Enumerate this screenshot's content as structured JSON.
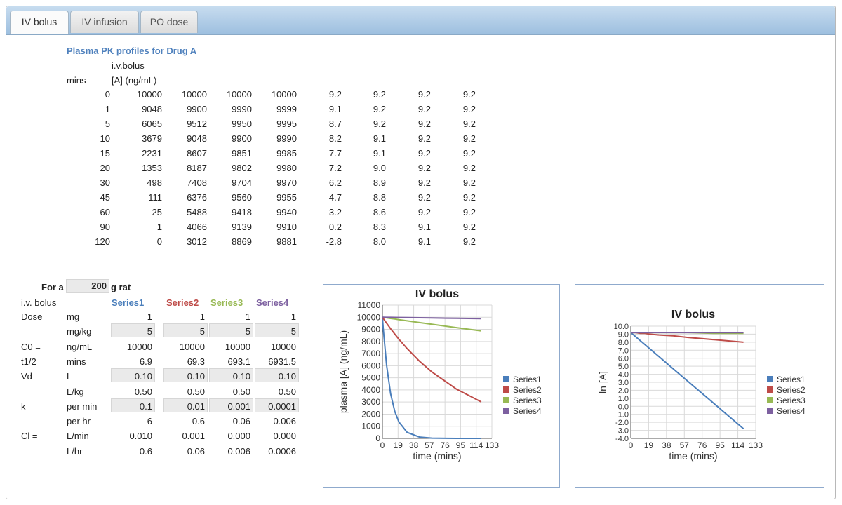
{
  "tabs": [
    {
      "label": "IV bolus",
      "active": true
    },
    {
      "label": "IV infusion",
      "active": false
    },
    {
      "label": "PO dose",
      "active": false
    }
  ],
  "table": {
    "title": "Plasma PK profiles for Drug A",
    "col_header_1": "i.v.bolus",
    "col_header_2": "[A] (ng/mL)",
    "time_header": "mins",
    "rows": [
      [
        "0",
        "10000",
        "10000",
        "10000",
        "10000",
        "9.2",
        "9.2",
        "9.2",
        "9.2"
      ],
      [
        "1",
        "9048",
        "9900",
        "9990",
        "9999",
        "9.1",
        "9.2",
        "9.2",
        "9.2"
      ],
      [
        "5",
        "6065",
        "9512",
        "9950",
        "9995",
        "8.7",
        "9.2",
        "9.2",
        "9.2"
      ],
      [
        "10",
        "3679",
        "9048",
        "9900",
        "9990",
        "8.2",
        "9.1",
        "9.2",
        "9.2"
      ],
      [
        "15",
        "2231",
        "8607",
        "9851",
        "9985",
        "7.7",
        "9.1",
        "9.2",
        "9.2"
      ],
      [
        "20",
        "1353",
        "8187",
        "9802",
        "9980",
        "7.2",
        "9.0",
        "9.2",
        "9.2"
      ],
      [
        "30",
        "498",
        "7408",
        "9704",
        "9970",
        "6.2",
        "8.9",
        "9.2",
        "9.2"
      ],
      [
        "45",
        "111",
        "6376",
        "9560",
        "9955",
        "4.7",
        "8.8",
        "9.2",
        "9.2"
      ],
      [
        "60",
        "25",
        "5488",
        "9418",
        "9940",
        "3.2",
        "8.6",
        "9.2",
        "9.2"
      ],
      [
        "90",
        "1",
        "4066",
        "9139",
        "9910",
        "0.2",
        "8.3",
        "9.1",
        "9.2"
      ],
      [
        "120",
        "0",
        "3012",
        "8869",
        "9881",
        "-2.8",
        "8.0",
        "9.1",
        "9.2"
      ]
    ]
  },
  "params": {
    "for_a": "For a",
    "weight": "200",
    "weight_unit": "g rat",
    "section": "i.v. bolus",
    "series_headers": [
      "Series1",
      "Series2",
      "Series3",
      "Series4"
    ],
    "rows": [
      {
        "label": "Dose",
        "unit": "mg",
        "values": [
          "1",
          "1",
          "1",
          "1"
        ],
        "input": false
      },
      {
        "label": "",
        "unit": "mg/kg",
        "values": [
          "5",
          "5",
          "5",
          "5"
        ],
        "input": true
      },
      {
        "label": "C0 =",
        "unit": "ng/mL",
        "values": [
          "10000",
          "10000",
          "10000",
          "10000"
        ],
        "input": false
      },
      {
        "label": "t1/2 =",
        "unit": "mins",
        "values": [
          "6.9",
          "69.3",
          "693.1",
          "6931.5"
        ],
        "input": false
      },
      {
        "label": "Vd",
        "unit": "L",
        "values": [
          "0.10",
          "0.10",
          "0.10",
          "0.10"
        ],
        "input": true
      },
      {
        "label": "",
        "unit": "L/kg",
        "values": [
          "0.50",
          "0.50",
          "0.50",
          "0.50"
        ],
        "input": false
      },
      {
        "label": "k",
        "unit": "per min",
        "values": [
          "0.1",
          "0.01",
          "0.001",
          "0.0001"
        ],
        "input": true
      },
      {
        "label": "",
        "unit": "per hr",
        "values": [
          "6",
          "0.6",
          "0.06",
          "0.006"
        ],
        "input": false
      },
      {
        "label": "Cl =",
        "unit": "L/min",
        "values": [
          "0.010",
          "0.001",
          "0.000",
          "0.000"
        ],
        "input": false
      },
      {
        "label": "",
        "unit": "L/hr",
        "values": [
          "0.6",
          "0.06",
          "0.006",
          "0.0006"
        ],
        "input": false
      }
    ]
  },
  "colors": {
    "series": [
      "#4a7ebb",
      "#be4b48",
      "#98b954",
      "#7d60a0"
    ],
    "accent": "#4f81bd",
    "tab_bar": "#a9c8e6"
  },
  "chart_data": [
    {
      "type": "line",
      "title": "IV bolus",
      "xlabel": "time (mins)",
      "ylabel": "plasma [A] (ng/mL)",
      "xlim": [
        0,
        133
      ],
      "ylim": [
        0,
        11000
      ],
      "xticks": [
        0,
        19,
        38,
        57,
        76,
        95,
        114,
        133
      ],
      "yticks": [
        0,
        1000,
        2000,
        3000,
        4000,
        5000,
        6000,
        7000,
        8000,
        9000,
        10000,
        11000
      ],
      "ytick_decimals": 0,
      "legend": "right",
      "x": [
        0,
        1,
        5,
        10,
        15,
        20,
        30,
        45,
        60,
        90,
        120
      ],
      "series": [
        {
          "name": "Series1",
          "values": [
            10000,
            9048,
            6065,
            3679,
            2231,
            1353,
            498,
            111,
            25,
            1,
            0
          ]
        },
        {
          "name": "Series2",
          "values": [
            10000,
            9900,
            9512,
            9048,
            8607,
            8187,
            7408,
            6376,
            5488,
            4066,
            3012
          ]
        },
        {
          "name": "Series3",
          "values": [
            10000,
            9990,
            9950,
            9900,
            9851,
            9802,
            9704,
            9560,
            9418,
            9139,
            8869
          ]
        },
        {
          "name": "Series4",
          "values": [
            10000,
            9999,
            9995,
            9990,
            9985,
            9980,
            9970,
            9955,
            9940,
            9910,
            9881
          ]
        }
      ]
    },
    {
      "type": "line",
      "title": "IV bolus",
      "xlabel": "time (mins)",
      "ylabel": "ln [A]",
      "xlim": [
        0,
        133
      ],
      "ylim": [
        -4,
        10
      ],
      "xticks": [
        0,
        19,
        38,
        57,
        76,
        95,
        114,
        133
      ],
      "yticks": [
        -4,
        -3,
        -2,
        -1,
        0,
        1,
        2,
        3,
        4,
        5,
        6,
        7,
        8,
        9,
        10
      ],
      "ytick_decimals": 1,
      "legend": "right",
      "x": [
        0,
        1,
        5,
        10,
        15,
        20,
        30,
        45,
        60,
        90,
        120
      ],
      "series": [
        {
          "name": "Series1",
          "values": [
            9.2,
            9.1,
            8.7,
            8.2,
            7.7,
            7.2,
            6.2,
            4.7,
            3.2,
            0.2,
            -2.8
          ]
        },
        {
          "name": "Series2",
          "values": [
            9.2,
            9.2,
            9.2,
            9.1,
            9.1,
            9.0,
            8.9,
            8.8,
            8.6,
            8.3,
            8.0
          ]
        },
        {
          "name": "Series3",
          "values": [
            9.2,
            9.2,
            9.2,
            9.2,
            9.2,
            9.2,
            9.2,
            9.2,
            9.2,
            9.1,
            9.1
          ]
        },
        {
          "name": "Series4",
          "values": [
            9.2,
            9.2,
            9.2,
            9.2,
            9.2,
            9.2,
            9.2,
            9.2,
            9.2,
            9.2,
            9.2
          ]
        }
      ]
    }
  ]
}
